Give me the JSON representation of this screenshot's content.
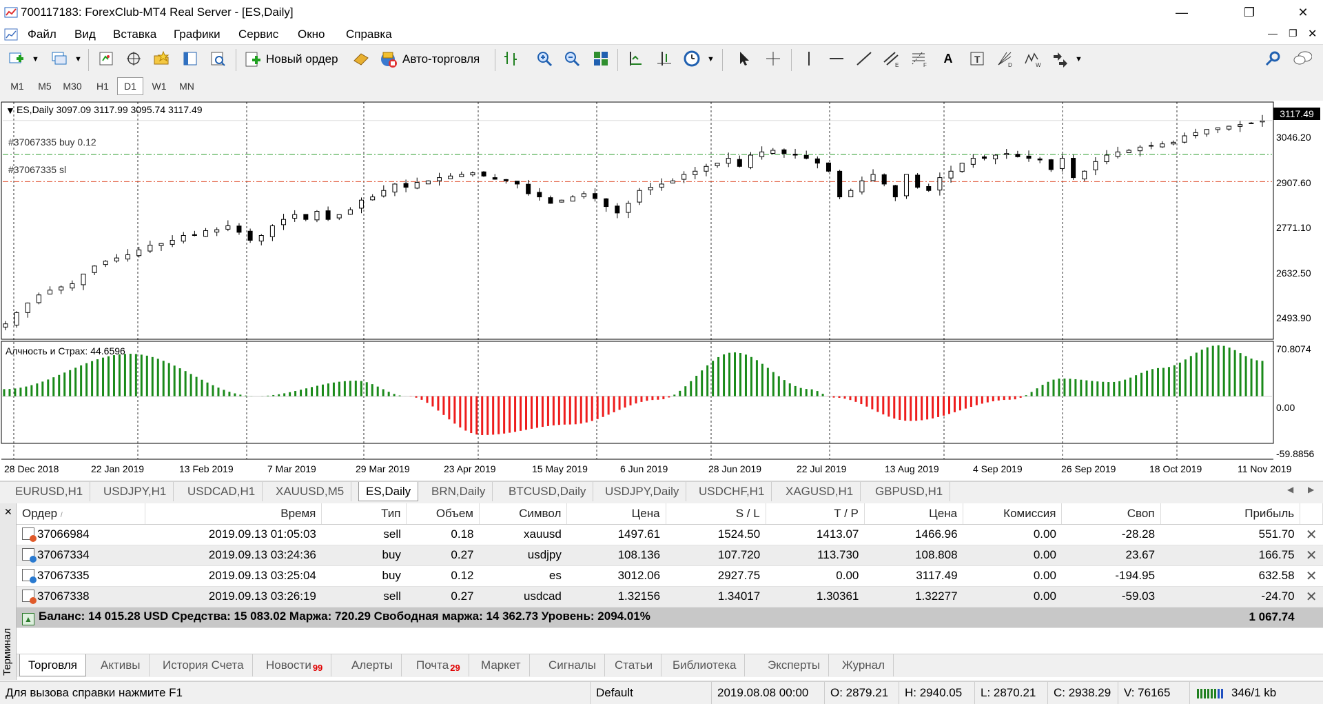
{
  "window": {
    "title": "700117183: ForexClub-MT4 Real Server - [ES,Daily]"
  },
  "menu": [
    "Файл",
    "Вид",
    "Вставка",
    "Графики",
    "Сервис",
    "Окно",
    "Справка"
  ],
  "toolbar": {
    "new_order": "Новый ордер",
    "auto_trading": "Авто-торговля"
  },
  "periods": [
    "M1",
    "M5",
    "M30",
    "H1",
    "D1",
    "W1",
    "MN"
  ],
  "active_period": "D1",
  "chart": {
    "header": "ES,Daily  3097.09 3117.99 3095.74 3117.49",
    "order_buy_label": "#37067335 buy 0.12",
    "order_sl_label": "#37067335 sl",
    "current_price": "3117.49",
    "price_labels": [
      "3046.20",
      "2907.60",
      "2771.10",
      "2632.50",
      "2493.90"
    ],
    "indicator_label": "Алчность и Страх: 44.6596",
    "indicator_labels": [
      "70.8074",
      "0.00",
      "-59.8856"
    ],
    "date_labels": [
      "28 Dec 2018",
      "22 Jan 2019",
      "13 Feb 2019",
      "7 Mar 2019",
      "29 Mar 2019",
      "23 Apr 2019",
      "15 May 2019",
      "6 Jun 2019",
      "28 Jun 2019",
      "22 Jul 2019",
      "13 Aug 2019",
      "4 Sep 2019",
      "26 Sep 2019",
      "18 Oct 2019",
      "11 Nov 2019"
    ],
    "colors": {
      "positive": "#1a8a1a",
      "negative": "#ee1c1c",
      "buy_line": "#2e9e2e",
      "sl_line": "#e05030"
    }
  },
  "chart_data": {
    "type": "candlestick",
    "symbol": "ES",
    "timeframe": "Daily",
    "ohlc_last": {
      "open": 3097.09,
      "high": 3117.99,
      "low": 3095.74,
      "close": 3117.49
    },
    "lines": {
      "buy": 3012.06,
      "sl": 2927.75
    },
    "closes": [
      2485,
      2520,
      2550,
      2575,
      2590,
      2600,
      2610,
      2640,
      2665,
      2680,
      2690,
      2700,
      2715,
      2730,
      2735,
      2745,
      2760,
      2760,
      2775,
      2778,
      2790,
      2770,
      2745,
      2760,
      2790,
      2810,
      2825,
      2810,
      2835,
      2810,
      2825,
      2840,
      2870,
      2880,
      2900,
      2920,
      2910,
      2925,
      2930,
      2940,
      2945,
      2950,
      2955,
      2945,
      2935,
      2930,
      2920,
      2890,
      2880,
      2860,
      2870,
      2880,
      2890,
      2875,
      2850,
      2830,
      2860,
      2900,
      2910,
      2920,
      2930,
      2950,
      2960,
      2975,
      2985,
      3000,
      2975,
      3010,
      3020,
      3025,
      3015,
      3010,
      3000,
      2985,
      2960,
      2880,
      2900,
      2930,
      2950,
      2920,
      2880,
      2950,
      2910,
      2900,
      2940,
      2960,
      2985,
      3000,
      3000,
      3010,
      3015,
      3005,
      3000,
      2995,
      2965,
      3000,
      2940,
      2960,
      2990,
      3010,
      3020,
      3025,
      3035,
      3040,
      3045,
      3050,
      3070,
      3080,
      3090,
      3095,
      3100,
      3105,
      3110,
      3117
    ],
    "indicator": {
      "name": "Алчность и Страх",
      "value": 44.6596,
      "ylim": [
        -59.8856,
        70.8074
      ]
    }
  },
  "symbol_tabs": [
    "EURUSD,H1",
    "USDJPY,H1",
    "USDCAD,H1",
    "XAUUSD,M5",
    "ES,Daily",
    "BRN,Daily",
    "BTCUSD,Daily",
    "USDJPY,Daily",
    "USDCHF,H1",
    "XAGUSD,H1",
    "GBPUSD,H1"
  ],
  "active_symbol_tab": "ES,Daily",
  "orders": {
    "columns": [
      "Ордер",
      "Время",
      "Тип",
      "Объем",
      "Символ",
      "Цена",
      "S / L",
      "T / P",
      "Цена",
      "Комиссия",
      "Своп",
      "Прибыль"
    ],
    "rows": [
      [
        "37066984",
        "2019.09.13 01:05:03",
        "sell",
        "0.18",
        "xauusd",
        "1497.61",
        "1524.50",
        "1413.07",
        "1466.96",
        "0.00",
        "-28.28",
        "551.70"
      ],
      [
        "37067334",
        "2019.09.13 03:24:36",
        "buy",
        "0.27",
        "usdjpy",
        "108.136",
        "107.720",
        "113.730",
        "108.808",
        "0.00",
        "23.67",
        "166.75"
      ],
      [
        "37067335",
        "2019.09.13 03:25:04",
        "buy",
        "0.12",
        "es",
        "3012.06",
        "2927.75",
        "0.00",
        "3117.49",
        "0.00",
        "-194.95",
        "632.58"
      ],
      [
        "37067338",
        "2019.09.13 03:26:19",
        "sell",
        "0.27",
        "usdcad",
        "1.32156",
        "1.34017",
        "1.30361",
        "1.32277",
        "0.00",
        "-59.03",
        "-24.70"
      ]
    ],
    "balance": "Баланс: 14 015.28 USD  Средства: 15 083.02  Маржа: 720.29  Свободная маржа: 14 362.73  Уровень: 2094.01%",
    "total_profit": "1 067.74"
  },
  "terminal": {
    "side_label": "Терминал"
  },
  "bottom_tabs": [
    {
      "label": "Торговля",
      "badge": ""
    },
    {
      "label": "Активы",
      "badge": ""
    },
    {
      "label": "История Счета",
      "badge": ""
    },
    {
      "label": "Новости",
      "badge": "99"
    },
    {
      "label": "Алерты",
      "badge": ""
    },
    {
      "label": "Почта",
      "badge": "29"
    },
    {
      "label": "Маркет",
      "badge": ""
    },
    {
      "label": "Сигналы",
      "badge": ""
    },
    {
      "label": "Статьи",
      "badge": ""
    },
    {
      "label": "Библиотека",
      "badge": ""
    },
    {
      "label": "Эксперты",
      "badge": ""
    },
    {
      "label": "Журнал",
      "badge": ""
    }
  ],
  "statusbar": {
    "help": "Для вызова справки нажмите F1",
    "profile": "Default",
    "datetime": "2019.08.08 00:00",
    "open": "O: 2879.21",
    "high": "H: 2940.05",
    "low": "L: 2870.21",
    "close": "C: 2938.29",
    "volume": "V: 76165",
    "traffic": "346/1 kb"
  }
}
